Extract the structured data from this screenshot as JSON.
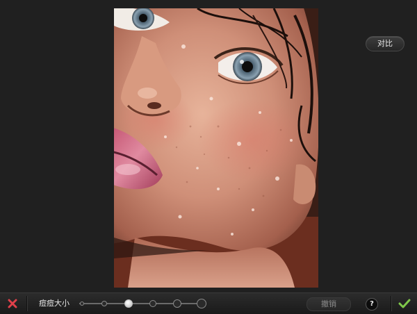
{
  "toolbar": {
    "cancel_icon": "close-x-icon",
    "size_label": "痘痘大小",
    "undo_label": "撤销",
    "help_label": "?",
    "confirm_icon": "checkmark-icon"
  },
  "compare_label": "对比",
  "brush_size": {
    "selected_index": 2,
    "stop_count": 6
  },
  "colors": {
    "cancel_red": "#e0404a",
    "confirm_green": "#7fc84a",
    "toolbar_bg": "#242424",
    "canvas_bg": "#202020"
  }
}
